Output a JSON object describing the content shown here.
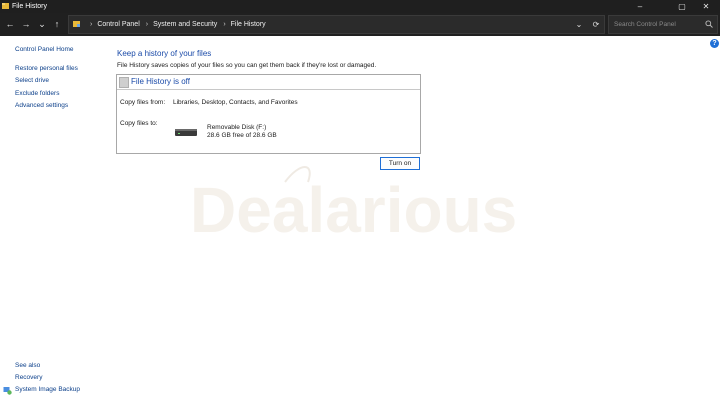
{
  "window": {
    "title": "File History",
    "minimize": "–",
    "maximize": "▢",
    "close": "✕"
  },
  "nav": {
    "back": "←",
    "forward": "→",
    "recent": "⌄",
    "up": "↑"
  },
  "address": {
    "crumbs": [
      "Control Panel",
      "System and Security",
      "File History"
    ],
    "separator": "›"
  },
  "search": {
    "placeholder": "Search Control Panel"
  },
  "sidebar": {
    "home": "Control Panel Home",
    "links": [
      "Restore personal files",
      "Select drive",
      "Exclude folders",
      "Advanced settings"
    ],
    "see_also": "See also",
    "see_also_links": [
      "Recovery",
      "System Image Backup"
    ]
  },
  "main": {
    "heading": "Keep a history of your files",
    "description": "File History saves copies of your files so you can get them back if they're lost or damaged.",
    "status": "File History is off",
    "copy_from_label": "Copy files from:",
    "copy_from_value": "Libraries, Desktop, Contacts, and Favorites",
    "copy_to_label": "Copy files to:",
    "drive_name": "Removable Disk (F:)",
    "drive_free": "28.6 GB free of 28.6 GB",
    "turn_on": "Turn on"
  },
  "watermark": {
    "text": "Dealarious"
  },
  "colors": {
    "accent": "#1f6fd6",
    "link": "#0b3f8a",
    "heading": "#1a4aa8",
    "titlebar": "#1f1f1f"
  }
}
